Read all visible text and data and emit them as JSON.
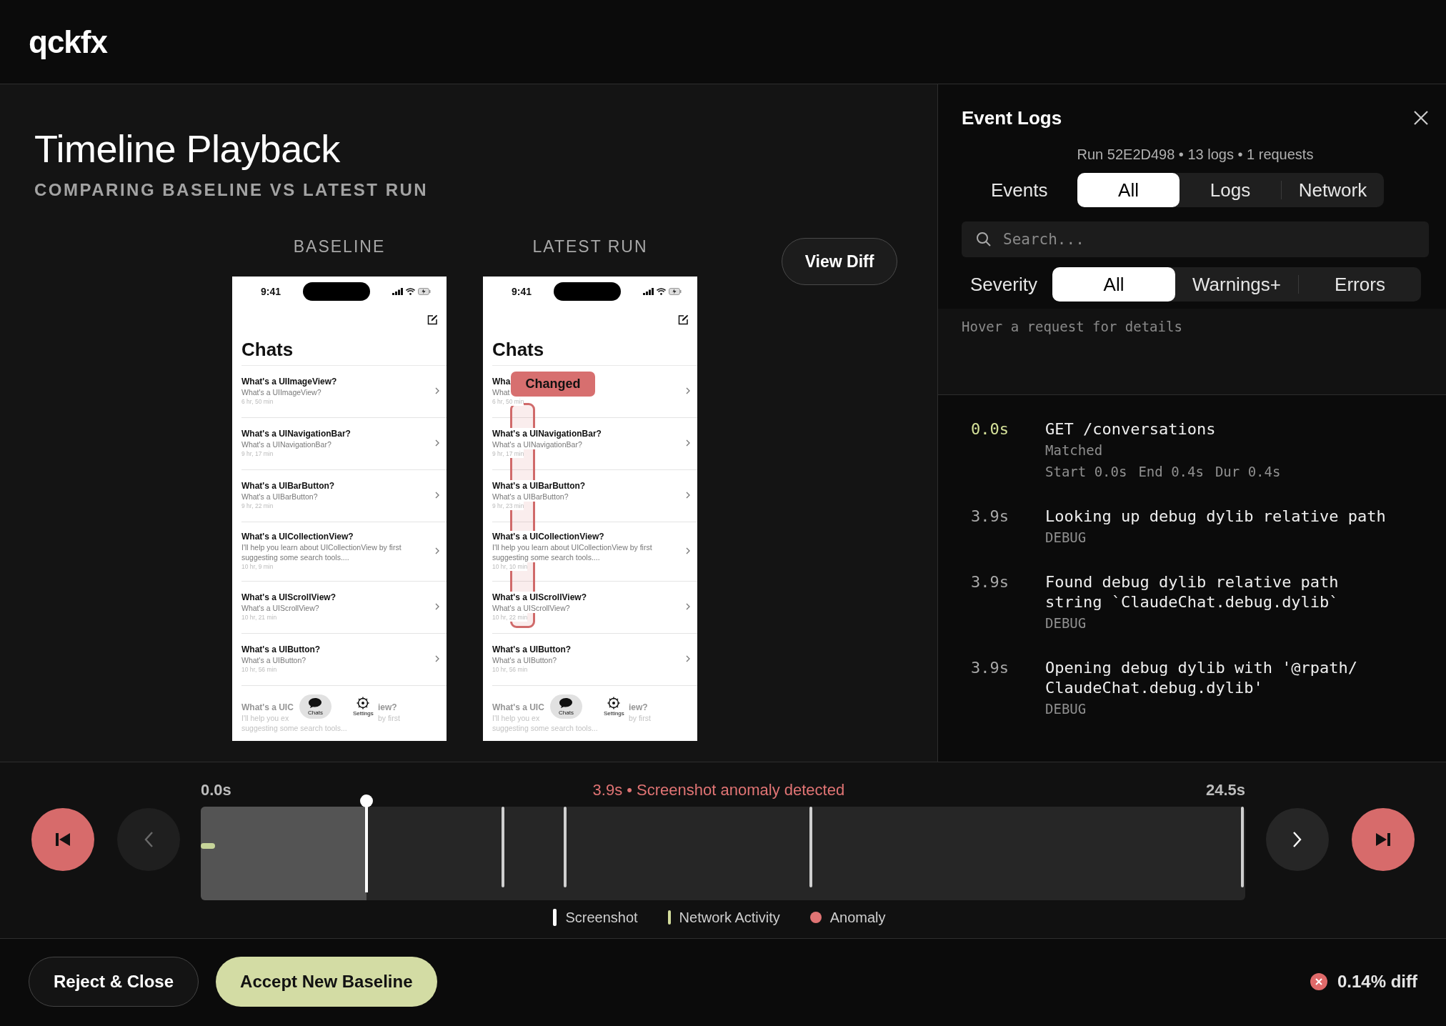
{
  "app": {
    "logo": "qckfx"
  },
  "playback": {
    "title": "Timeline Playback",
    "subtitle": "COMPARING BASELINE VS LATEST RUN",
    "view_diff": "View Diff",
    "screens": [
      {
        "label": "BASELINE",
        "phone": {
          "time": "9:41",
          "heading": "Chats",
          "rows": [
            {
              "title": "What's a UIImageView?",
              "subtitle": "What's a UIImageView?",
              "time": "6 hr, 50 min"
            },
            {
              "title": "What's a UINavigationBar?",
              "subtitle": "What's a UINavigationBar?",
              "time": "9 hr, 17 min"
            },
            {
              "title": "What's a UIBarButton?",
              "subtitle": "What's a UIBarButton?",
              "time": "9 hr, 22 min"
            },
            {
              "title": "What's a UICollectionView?",
              "subtitle": "I'll help you learn about UICollectionView by first suggesting some search tools....",
              "time": "10 hr, 9 min"
            },
            {
              "title": "What's a UIScrollView?",
              "subtitle": "What's a UIScrollView?",
              "time": "10 hr, 21 min"
            },
            {
              "title": "What's a UIButton?",
              "subtitle": "What's a UIButton?",
              "time": "10 hr, 56 min"
            }
          ],
          "last_row": {
            "title": "What's a UIC",
            "title_tail": "iew?",
            "subtitle": "I'll help you ex",
            "subtitle_tail": "by first",
            "subtitle_2": "suggesting some search tools..."
          },
          "tabs": [
            {
              "label": "Chats",
              "selected": true
            },
            {
              "label": "Settings",
              "selected": false
            }
          ]
        }
      },
      {
        "label": "LATEST RUN",
        "anomaly": {
          "label": "Changed"
        },
        "phone": {
          "time": "9:41",
          "heading": "Chats",
          "rows": [
            {
              "title": "Wha",
              "subtitle": "What",
              "time": "6 hr, 50 min"
            },
            {
              "title": "What's a UINavigationBar?",
              "subtitle": "What's a UINavigationBar?",
              "time": "9 hr, 17 min"
            },
            {
              "title": "What's a UIBarButton?",
              "subtitle": "What's a UIBarButton?",
              "time": "9 hr, 23 min"
            },
            {
              "title": "What's a UICollectionView?",
              "subtitle": "I'll help you learn about UICollectionView by first suggesting some search tools....",
              "time": "10 hr, 10 min"
            },
            {
              "title": "What's a UIScrollView?",
              "subtitle": "What's a UIScrollView?",
              "time": "10 hr, 22 min"
            },
            {
              "title": "What's a UIButton?",
              "subtitle": "What's a UIButton?",
              "time": "10 hr, 56 min"
            }
          ],
          "last_row": {
            "title": "What's a UIC",
            "title_tail": "iew?",
            "subtitle": "I'll help you ex",
            "subtitle_tail": "by first",
            "subtitle_2": "suggesting some search tools..."
          },
          "tabs": [
            {
              "label": "Chats",
              "selected": true
            },
            {
              "label": "Settings",
              "selected": false
            }
          ]
        }
      }
    ]
  },
  "event_logs": {
    "title": "Event Logs",
    "run_info": "Run 52E2D498 • 13 logs • 1 requests",
    "event_filter": {
      "label": "Events",
      "options": [
        {
          "label": "All",
          "selected": true
        },
        {
          "label": "Logs",
          "selected": false
        },
        {
          "label": "Network",
          "selected": false
        }
      ]
    },
    "search": {
      "placeholder": "Search..."
    },
    "severity_filter": {
      "label": "Severity",
      "options": [
        {
          "label": "All",
          "selected": true
        },
        {
          "label": "Warnings+",
          "selected": false
        },
        {
          "label": "Errors",
          "selected": false
        }
      ]
    },
    "hint": "Hover a request for details",
    "entries": [
      {
        "kind": "request",
        "time": "0.0s",
        "lines": [
          "GET /conversations"
        ],
        "status": "Matched",
        "timing": [
          "Start 0.0s",
          "End 0.4s",
          "Dur 0.4s"
        ]
      },
      {
        "kind": "log",
        "time": "3.9s",
        "lines": [
          "Looking up debug dylib relative path"
        ],
        "severity": "DEBUG"
      },
      {
        "kind": "log",
        "time": "3.9s",
        "lines": [
          "Found debug dylib relative path",
          "string `ClaudeChat.debug.dylib`"
        ],
        "severity": "DEBUG"
      },
      {
        "kind": "log",
        "time": "3.9s",
        "lines": [
          "Opening debug dylib with '@rpath/",
          "ClaudeChat.debug.dylib'"
        ],
        "severity": "DEBUG"
      }
    ]
  },
  "timeline": {
    "start": "0.0s",
    "end": "24.5s",
    "status": "3.9s • Screenshot anomaly detected",
    "level": 0.159,
    "controls": [
      {
        "kind": "first",
        "disabled": false
      },
      {
        "kind": "prev",
        "disabled": true
      },
      {
        "kind": "next",
        "disabled": false
      },
      {
        "kind": "last",
        "disabled": false
      }
    ],
    "markers": [
      {
        "kind": "network",
        "level": 0.0
      },
      {
        "kind": "screenshot",
        "level": 0.289
      },
      {
        "kind": "screenshot",
        "level": 0.349
      },
      {
        "kind": "screenshot",
        "level": 0.584
      },
      {
        "kind": "screenshot",
        "level": 0.997
      }
    ],
    "legend": [
      {
        "kind": "screenshot",
        "label": "Screenshot"
      },
      {
        "kind": "network",
        "label": "Network Activity"
      },
      {
        "kind": "anomaly",
        "label": "Anomaly"
      }
    ]
  },
  "footer": {
    "reject": "Reject & Close",
    "accept": "Accept New Baseline",
    "diff": "0.14% diff"
  }
}
